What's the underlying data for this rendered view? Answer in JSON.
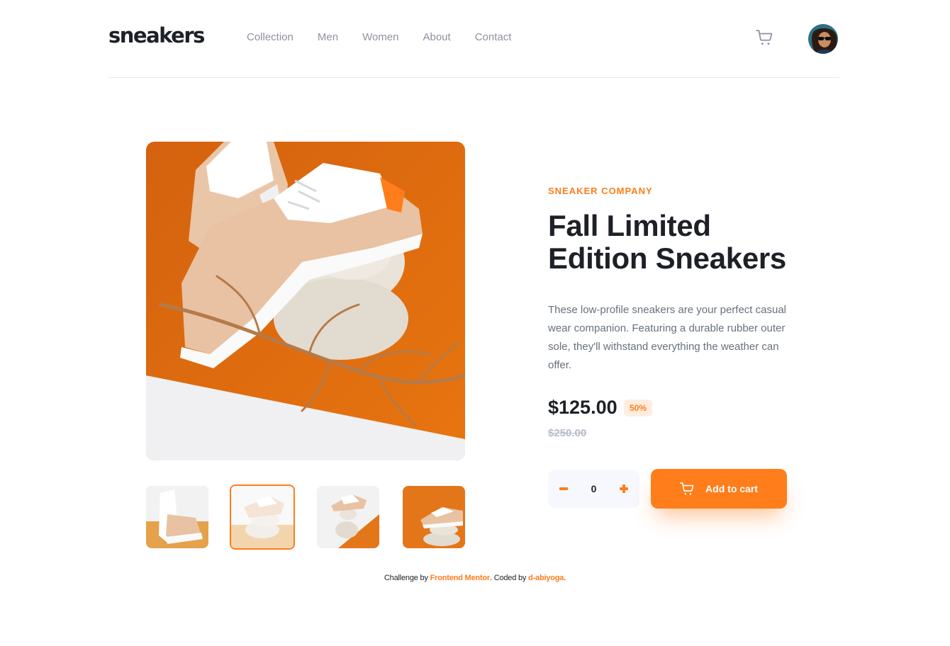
{
  "header": {
    "logo": "sneakers",
    "nav": [
      "Collection",
      "Men",
      "Women",
      "About",
      "Contact"
    ]
  },
  "gallery": {
    "thumbnails_count": 4,
    "active_thumbnail": 2
  },
  "product": {
    "company": "SNEAKER COMPANY",
    "title_line1": "Fall Limited",
    "title_line2": "Edition Sneakers",
    "description": "These low-profile sneakers are your perfect casual wear companion. Featuring a durable rubber outer sole, they'll withstand everything the weather can offer.",
    "price": "$125.00",
    "discount": "50%",
    "original_price": "$250.00",
    "quantity": "0",
    "add_to_cart_label": "Add to cart"
  },
  "footer": {
    "challenge_prefix": "Challenge by ",
    "challenge_link": "Frontend Mentor",
    "coded_prefix": ". Coded by ",
    "coded_link": "d-abiyoga",
    "suffix": "."
  },
  "colors": {
    "accent": "#ff7d1a",
    "accent_pale": "#ffede0",
    "text_dark": "#1d2026",
    "text_gray": "#68707d",
    "nav_gray": "#8f92a0",
    "qty_bg": "#f6f8fd"
  },
  "icons": {
    "cart": "cart-icon",
    "minus": "minus-icon",
    "plus": "plus-icon"
  }
}
